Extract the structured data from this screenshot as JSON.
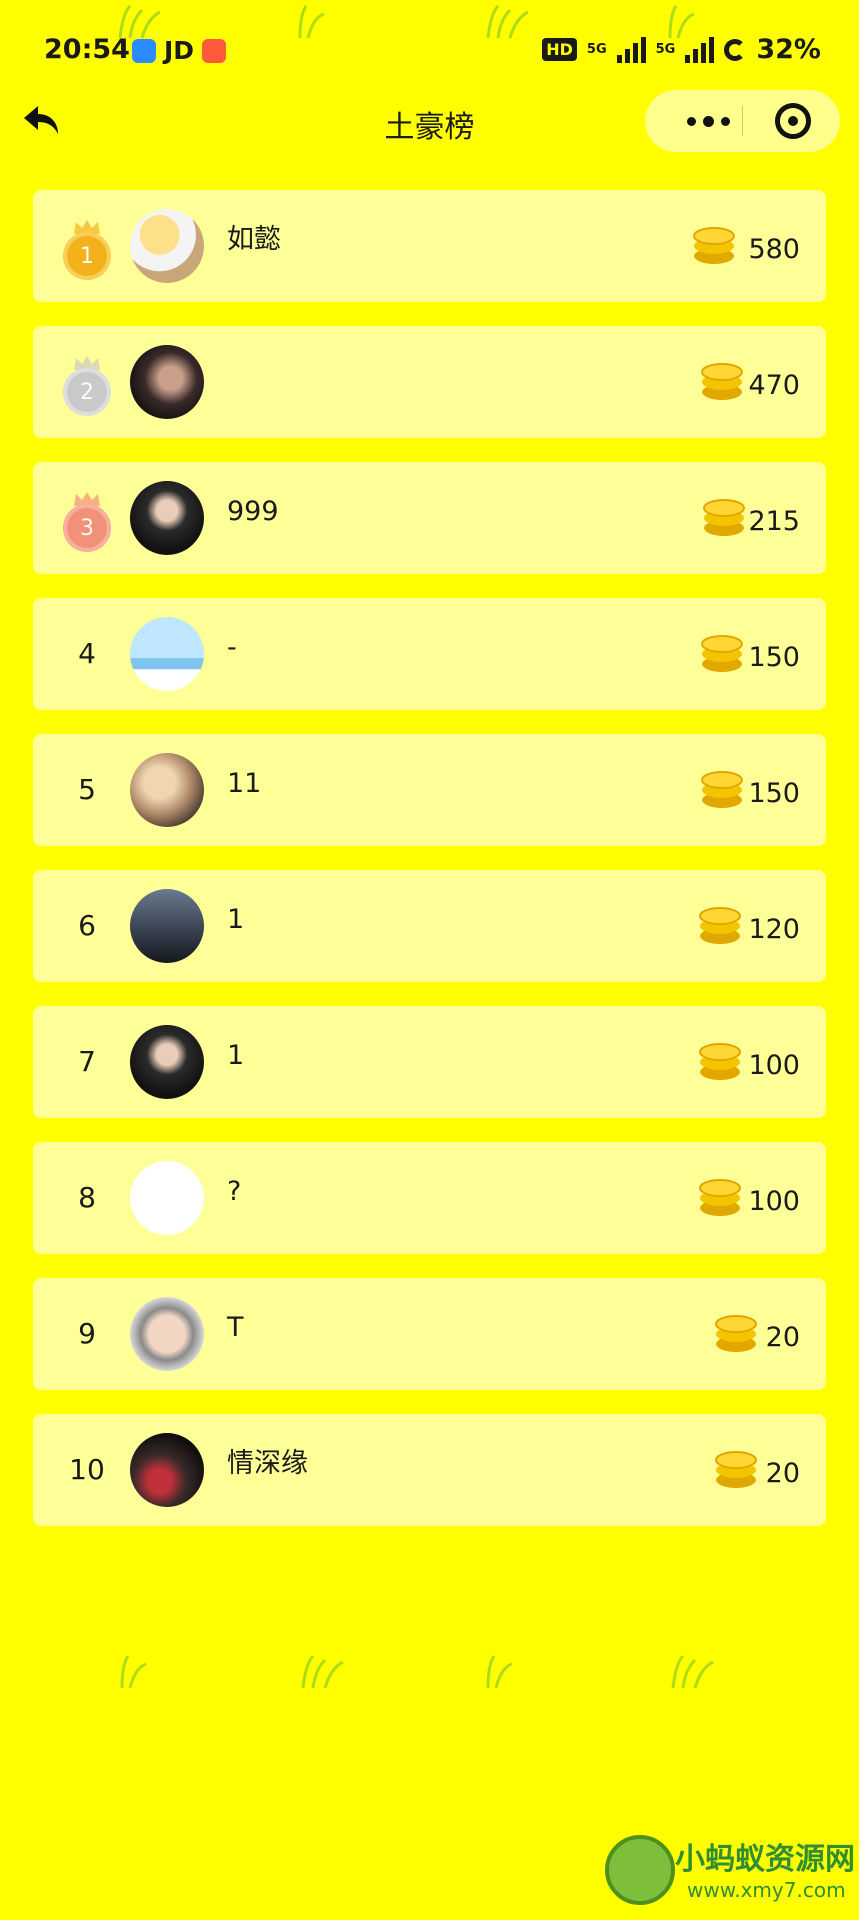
{
  "status_bar": {
    "time": "20:54",
    "app_label": "JD",
    "hd": "HD",
    "network": "5G",
    "battery": "32%"
  },
  "nav": {
    "title": "土豪榜"
  },
  "colors": {
    "background": "#ffff00",
    "row_background": "#ffffd2",
    "gold_medal": "#f3b21c",
    "silver_medal": "#c9c9c9",
    "bronze_medal": "#f39178",
    "coin": "#f5c400"
  },
  "ranking": [
    {
      "rank": "1",
      "medal": "gold",
      "name": "如懿",
      "amount": "580"
    },
    {
      "rank": "2",
      "medal": "silver",
      "name": "",
      "amount": "470"
    },
    {
      "rank": "3",
      "medal": "bronze",
      "name": "999",
      "amount": "215"
    },
    {
      "rank": "4",
      "medal": "",
      "name": "-",
      "amount": "150"
    },
    {
      "rank": "5",
      "medal": "",
      "name": "11",
      "amount": "150"
    },
    {
      "rank": "6",
      "medal": "",
      "name": "1",
      "amount": "120"
    },
    {
      "rank": "7",
      "medal": "",
      "name": "1",
      "amount": "100"
    },
    {
      "rank": "8",
      "medal": "",
      "name": "?",
      "amount": "100"
    },
    {
      "rank": "9",
      "medal": "",
      "name": "T",
      "amount": "20"
    },
    {
      "rank": "10",
      "medal": "",
      "name": "情深缘",
      "amount": "20"
    }
  ],
  "icons": {
    "back": "back-arrow-icon",
    "more": "more-dots-icon",
    "close": "target-close-icon",
    "coin": "coin-stack-icon",
    "crown": "crown-icon"
  },
  "watermark": {
    "name": "小蚂蚁资源网",
    "url": "www.xmy7.com"
  }
}
